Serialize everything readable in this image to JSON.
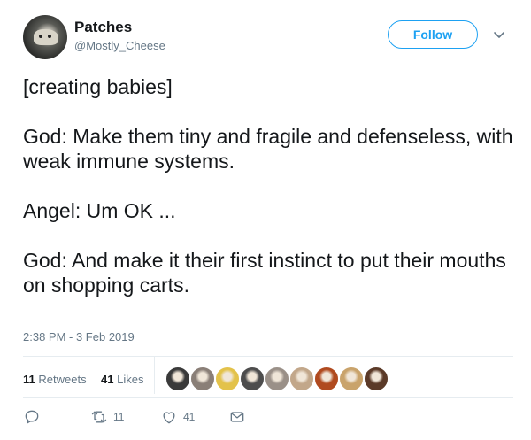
{
  "user": {
    "display_name": "Patches",
    "handle": "@Mostly_Cheese"
  },
  "follow_label": "Follow",
  "tweet": {
    "paragraphs": [
      "[creating babies]",
      "God: Make them tiny and fragile and defenseless, with weak immune systems.",
      "Angel: Um OK ...",
      "God: And make it their first instinct to put their mouths on shopping carts."
    ],
    "timestamp": "2:38 PM - 3 Feb 2019"
  },
  "stats": {
    "retweets_count": "11",
    "retweets_label": "Retweets",
    "likes_count": "41",
    "likes_label": "Likes"
  },
  "likers": [
    {
      "color": "#3a3a3a"
    },
    {
      "color": "#8a7f77"
    },
    {
      "color": "#e3c24a"
    },
    {
      "color": "#4d4d4d"
    },
    {
      "color": "#9a9088"
    },
    {
      "color": "#c2a78a"
    },
    {
      "color": "#b04a1f"
    },
    {
      "color": "#c9a36b"
    },
    {
      "color": "#5b3a28"
    }
  ],
  "actions": {
    "reply_count": "",
    "retweet_count": "11",
    "like_count": "41"
  },
  "icons": [
    "reply-icon",
    "retweet-icon",
    "like-icon",
    "message-icon",
    "chevron-down-icon"
  ],
  "colors": {
    "accent": "#1da1f2",
    "muted": "#657786",
    "text": "#14171a"
  }
}
